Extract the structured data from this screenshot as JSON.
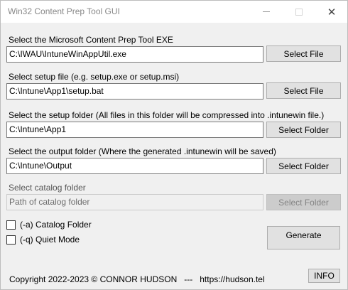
{
  "window": {
    "title": "Win32 Content Prep Tool GUI",
    "minimize_glyph": "—",
    "maximize_glyph": "☐",
    "close_glyph": "✕"
  },
  "exe": {
    "label": "Select the Microsoft Content Prep Tool EXE",
    "value": "C:\\IWAU\\IntuneWinAppUtil.exe",
    "button": "Select File"
  },
  "setup_file": {
    "label": "Select setup file (e.g. setup.exe or setup.msi)",
    "value": "C:\\Intune\\App1\\setup.bat",
    "button": "Select File"
  },
  "setup_folder": {
    "label": "Select the setup folder (All files in this folder will be compressed into .intunewin file.)",
    "value": "C:\\Intune\\App1",
    "button": "Select Folder"
  },
  "output_folder": {
    "label": "Select the output folder (Where the generated .intunewin will be saved)",
    "value": "C:\\Intune\\Output",
    "button": "Select Folder"
  },
  "catalog_folder": {
    "label": "Select catalog folder",
    "placeholder": "Path of catalog folder",
    "button": "Select Folder"
  },
  "options": {
    "catalog_label": "(-a) Catalog Folder",
    "quiet_label": "(-q) Quiet Mode"
  },
  "generate_button": "Generate",
  "footer": {
    "copyright": "Copyright 2022-2023 © CONNOR HUDSON   ---   https://hudson.tel",
    "info_button": "INFO"
  }
}
